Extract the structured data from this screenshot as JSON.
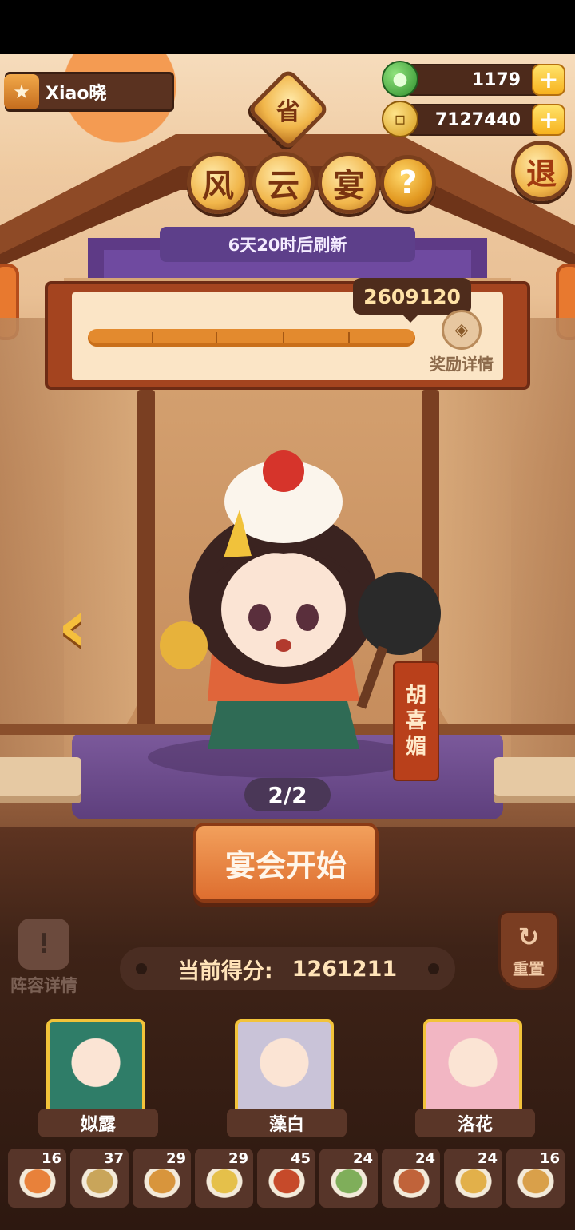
{
  "player": {
    "name": "Xiao晓"
  },
  "currency": {
    "jade": "1179",
    "gold": "7127440"
  },
  "badge": {
    "province": "省"
  },
  "event": {
    "title": [
      "风",
      "云",
      "宴"
    ],
    "help": "?",
    "refresh": "6天20时后刷新"
  },
  "exit_label": "退",
  "progress": {
    "score": "2609120",
    "reward_label": "奖励详情",
    "fill_fraction": 1.0
  },
  "character": {
    "name": [
      "胡",
      "喜",
      "媚"
    ],
    "page": "2/2"
  },
  "start_button": "宴会开始",
  "lineup_label": "阵容详情",
  "reset_label": "重置",
  "current_score": {
    "label": "当前得分:",
    "value": "1261211"
  },
  "team": [
    {
      "name": "姒露",
      "color": "#2f7d68"
    },
    {
      "name": "藻白",
      "color": "#c9c3d8"
    },
    {
      "name": "洛花",
      "color": "#f2b6c3"
    }
  ],
  "dishes": [
    {
      "count": "16",
      "color": "#e8813a"
    },
    {
      "count": "37",
      "color": "#c9a55a"
    },
    {
      "count": "29",
      "color": "#d8953c"
    },
    {
      "count": "29",
      "color": "#e5c04a"
    },
    {
      "count": "45",
      "color": "#c64a2a"
    },
    {
      "count": "24",
      "color": "#7fae5a"
    },
    {
      "count": "24",
      "color": "#c0633a"
    },
    {
      "count": "24",
      "color": "#e2b04a"
    },
    {
      "count": "16",
      "color": "#d9a04a"
    }
  ]
}
